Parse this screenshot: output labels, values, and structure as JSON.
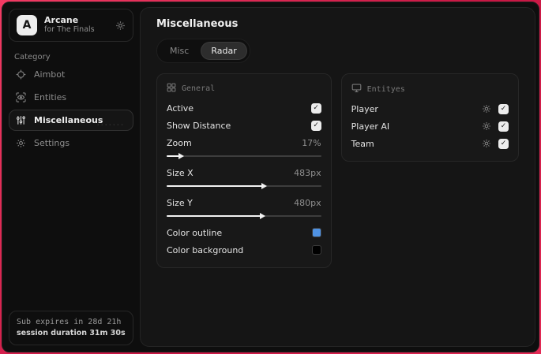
{
  "colors": {
    "backdrop_red": "#d91f4a",
    "outline_swatch": "#4f92e3",
    "background_swatch": "#000000"
  },
  "sidebar": {
    "app": {
      "name": "Arcane",
      "subtitle": "for The Finals",
      "logo_letter": "A"
    },
    "category_label": "Category",
    "items": [
      {
        "label": "Aimbot",
        "icon": "crosshair-icon",
        "active": false
      },
      {
        "label": "Entities",
        "icon": "eye-scan-icon",
        "active": false
      },
      {
        "label": "Miscellaneous",
        "icon": "sliders-icon",
        "active": true
      },
      {
        "label": "Settings",
        "icon": "gear-icon",
        "active": false
      }
    ],
    "watermark": "·······",
    "subscription": {
      "expires_text": "Sub expires in 28d 21h",
      "session_text": "session duration 31m 30s"
    }
  },
  "main": {
    "title": "Miscellaneous",
    "tabs": [
      {
        "label": "Misc",
        "active": false
      },
      {
        "label": "Radar",
        "active": true
      }
    ],
    "general": {
      "title": "General",
      "icon": "grid-icon",
      "toggles": [
        {
          "label": "Active",
          "checked": true
        },
        {
          "label": "Show Distance",
          "checked": true
        }
      ],
      "sliders": [
        {
          "label": "Zoom",
          "value": "17%",
          "percent": 8
        },
        {
          "label": "Size X",
          "value": "483px",
          "percent": 62
        },
        {
          "label": "Size Y",
          "value": "480px",
          "percent": 61
        }
      ],
      "color_rows": [
        {
          "label": "Color outline",
          "swatch": "#4f92e3"
        },
        {
          "label": "Color background",
          "swatch": "#000000"
        }
      ]
    },
    "entities": {
      "title": "Entityes",
      "icon": "monitor-icon",
      "rows": [
        {
          "label": "Player",
          "checked": true
        },
        {
          "label": "Player AI",
          "checked": true
        },
        {
          "label": "Team",
          "checked": true
        }
      ]
    }
  }
}
